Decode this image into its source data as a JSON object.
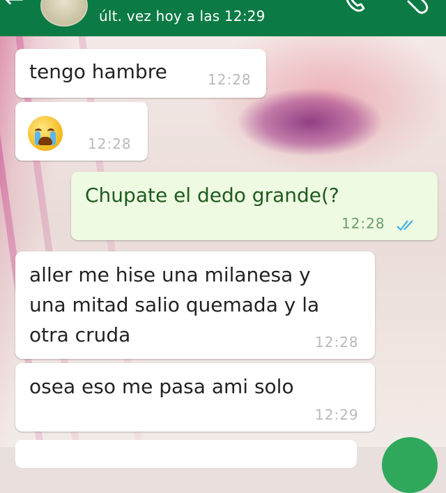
{
  "header": {
    "last_seen": "últ. vez hoy a las 12:29",
    "icons": [
      "back-arrow-icon",
      "avatar",
      "phone-icon",
      "paperclip-icon"
    ],
    "color": "#0b7a45"
  },
  "messages": [
    {
      "direction": "in",
      "text": "tengo hambre",
      "time": "12:28"
    },
    {
      "direction": "in",
      "emoji": "crying-face-emoji",
      "time": "12:28"
    },
    {
      "direction": "out",
      "text": "Chupate el dedo grande(?",
      "time": "12:28",
      "status": "read"
    },
    {
      "direction": "in",
      "lines": [
        "aller me hise una milanesa y",
        "una mitad salio quemada y la",
        "otra cruda"
      ],
      "time": "12:28"
    },
    {
      "direction": "in",
      "text": "osea eso me pasa ami solo",
      "time": "12:29"
    }
  ],
  "colors": {
    "incoming_bubble": "#ffffff",
    "outgoing_bubble": "#eefae1",
    "read_ticks": "#3fb0e6"
  }
}
